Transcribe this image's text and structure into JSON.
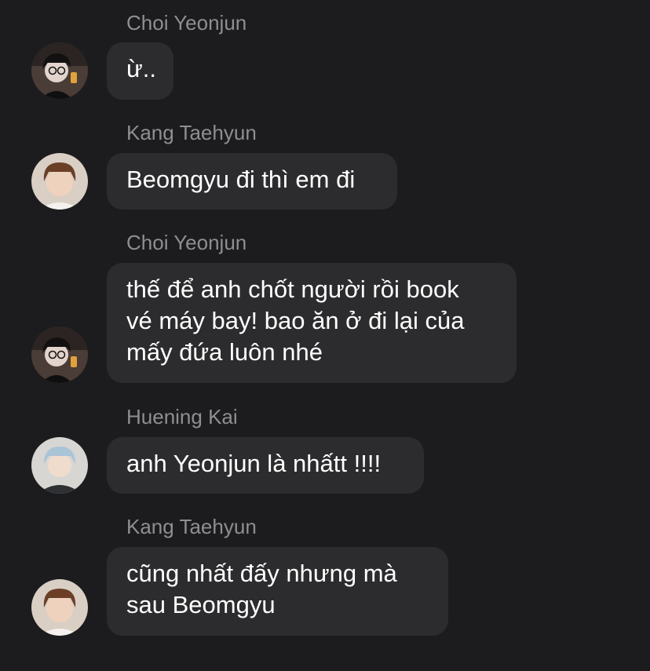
{
  "messages": [
    {
      "sender": "Choi Yeonjun",
      "text": "ừ..",
      "avatar": "avatar-dark-hair-glasses"
    },
    {
      "sender": "Kang Taehyun",
      "text": "Beomgyu đi thì em đi",
      "avatar": "avatar-brown-hair-light"
    },
    {
      "sender": "Choi Yeonjun",
      "text": "thế để anh chốt người rồi book\nvé máy bay! bao ăn ở đi lại của\nmấy đứa luôn nhé",
      "avatar": "avatar-dark-hair-glasses"
    },
    {
      "sender": "Huening Kai",
      "text": "anh Yeonjun là nhấtt !!!!",
      "avatar": "avatar-blue-hair"
    },
    {
      "sender": "Kang Taehyun",
      "text": "cũng nhất đấy nhưng mà\nsau Beomgyu",
      "avatar": "avatar-brown-hair-light"
    }
  ],
  "colors": {
    "background": "#1c1c1e",
    "bubble": "#2c2c2e",
    "sender_name": "#8e8e93",
    "message_text": "#ffffff"
  }
}
